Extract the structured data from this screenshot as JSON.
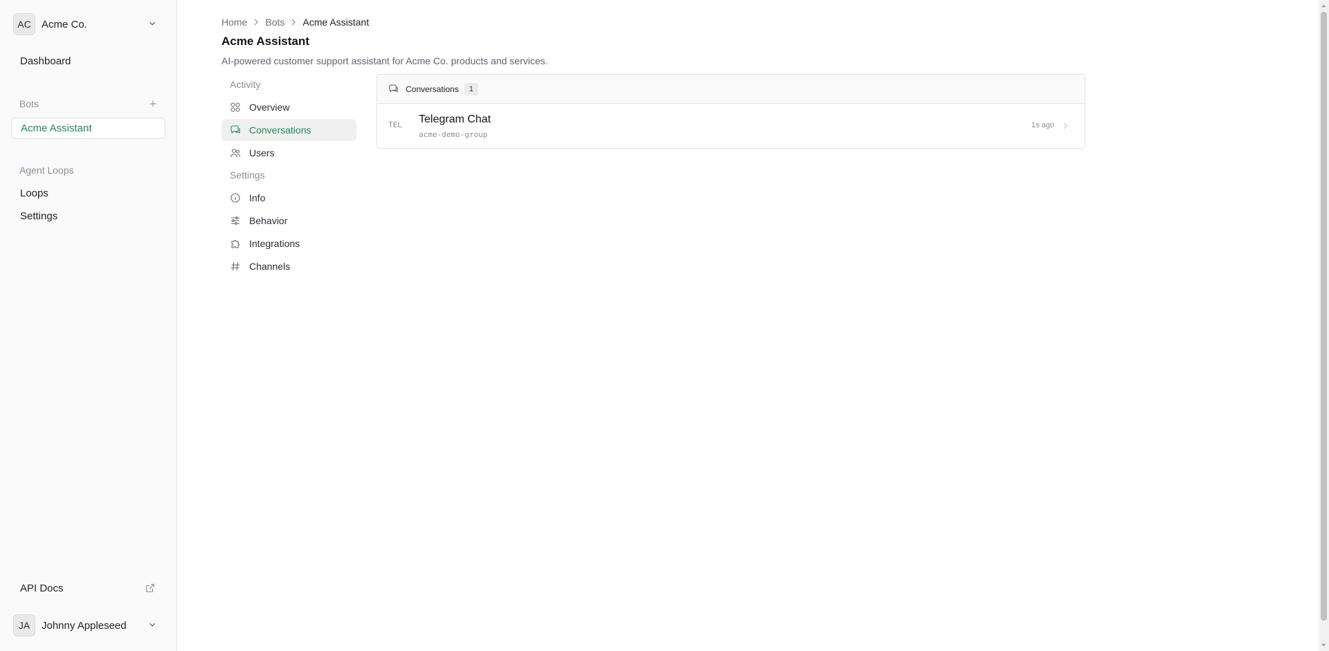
{
  "sidebar": {
    "org": {
      "initials": "AC",
      "name": "Acme Co."
    },
    "dashboard_label": "Dashboard",
    "bots_section": "Bots",
    "bots": [
      {
        "label": "Acme Assistant"
      }
    ],
    "agent_loops_section": "Agent Loops",
    "loops_label": "Loops",
    "settings_label": "Settings",
    "api_docs_label": "API Docs",
    "user": {
      "initials": "JA",
      "name": "Johnny Appleseed"
    }
  },
  "breadcrumb": [
    "Home",
    "Bots",
    "Acme Assistant"
  ],
  "page": {
    "title": "Acme Assistant",
    "description": "AI-powered customer support assistant for Acme Co. products and services."
  },
  "subnav": {
    "activity_section": "Activity",
    "activity_items": [
      {
        "label": "Overview",
        "icon": "grid-icon"
      },
      {
        "label": "Conversations",
        "icon": "chat-icon"
      },
      {
        "label": "Users",
        "icon": "users-icon"
      }
    ],
    "settings_section": "Settings",
    "settings_items": [
      {
        "label": "Info",
        "icon": "info-icon"
      },
      {
        "label": "Behavior",
        "icon": "sliders-icon"
      },
      {
        "label": "Integrations",
        "icon": "puzzle-icon"
      },
      {
        "label": "Channels",
        "icon": "hash-icon"
      }
    ]
  },
  "conversations": {
    "header": "Conversations",
    "count": "1",
    "items": [
      {
        "channel": "TEL",
        "title": "Telegram Chat",
        "subtitle": "acme-demo-group",
        "time": "1s ago"
      }
    ]
  },
  "colors": {
    "accent": "#1c8a57",
    "muted": "#8a8f96"
  }
}
